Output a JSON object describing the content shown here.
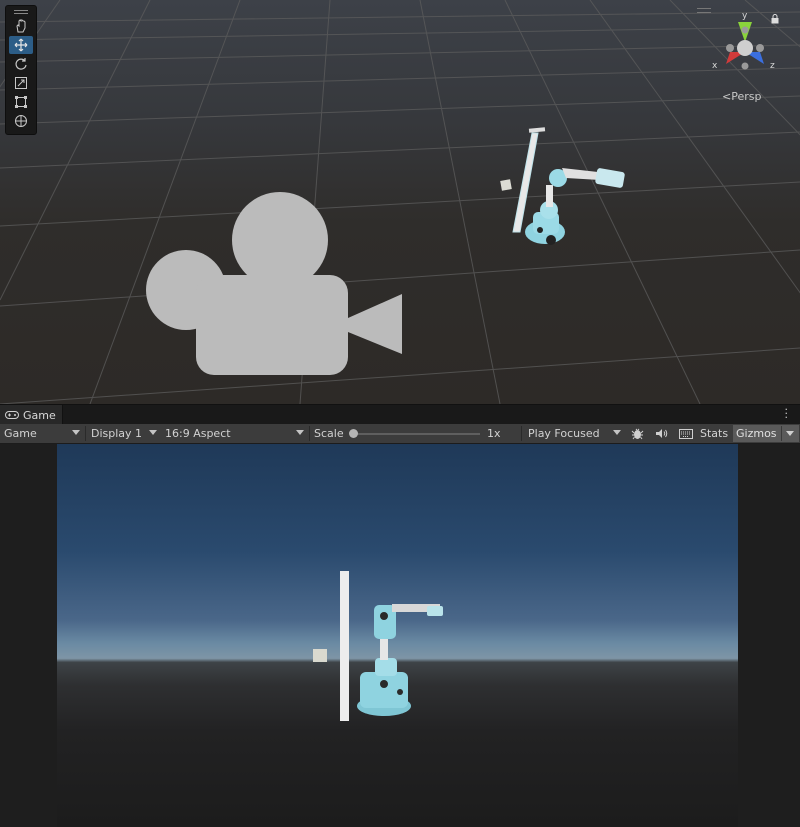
{
  "scene": {
    "camera_mode_label": "Persp",
    "tools": [
      {
        "name": "hand-tool",
        "active": false
      },
      {
        "name": "move-tool",
        "active": true
      },
      {
        "name": "rotate-tool",
        "active": false
      },
      {
        "name": "scale-tool",
        "active": false
      },
      {
        "name": "rect-tool",
        "active": false
      },
      {
        "name": "transform-tool",
        "active": false
      }
    ],
    "gizmo_axes": {
      "x": "x",
      "y": "y",
      "z": "z"
    },
    "icons": {
      "camera": "camera-icon",
      "lock": "lock-icon"
    }
  },
  "game": {
    "tab_label": "Game",
    "toolbar": {
      "view_select": "Game",
      "display_select": "Display 1",
      "aspect_select": "16:9 Aspect",
      "scale_label": "Scale",
      "scale_value": "1x",
      "scale_fraction": 0.0,
      "play_mode_select": "Play Focused",
      "stats_label": "Stats",
      "gizmos_label": "Gizmos"
    }
  },
  "colors": {
    "axis_x": "#d23a3a",
    "axis_y": "#8ad33b",
    "axis_z": "#3b6fe0",
    "robot": "#8fd3e0",
    "active_tool": "#2c5d87"
  }
}
